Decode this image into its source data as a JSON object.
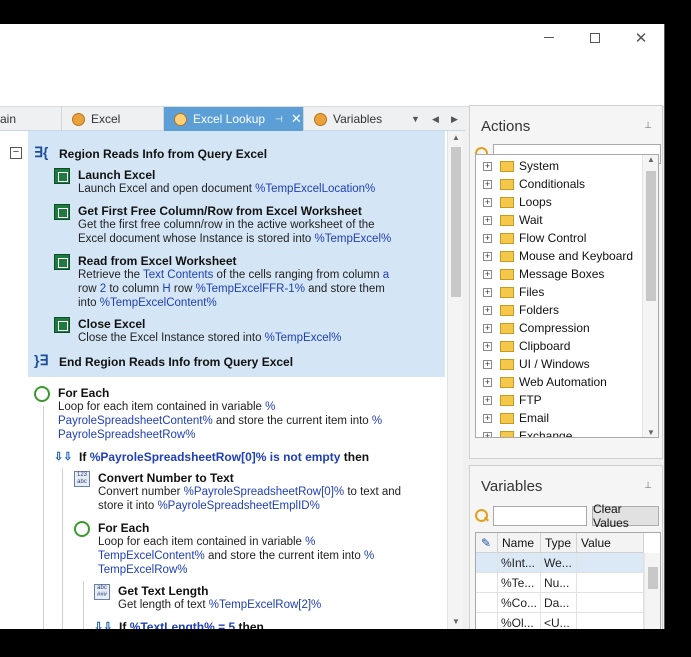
{
  "tabs": {
    "partial": "ain",
    "excel": "Excel",
    "excel_lookup": "Excel Lookup",
    "variables": "Variables"
  },
  "editor": {
    "region_start": "Region Reads Info from Query Excel",
    "region_end": "End Region Reads Info from Query Excel",
    "launch": {
      "title": "Launch Excel",
      "desc": "Launch Excel and open document",
      "var": "%TempExcelLocation%"
    },
    "free": {
      "title": "Get First Free Column/Row from Excel Worksheet",
      "l1": "Get the first free column/row in the active worksheet of the",
      "l2": "Excel document whose Instance is stored into",
      "var": "%TempExcel%"
    },
    "read": {
      "title": "Read from Excel Worksheet",
      "l1a": "Retrieve the",
      "l1v": "Text Contents",
      "l1b": "of the cells ranging from column",
      "l1v2": "a",
      "l2a": "row",
      "l2v": "2",
      "l2b": "to column",
      "l2v2": "H",
      "l2c": "row",
      "l2v3": "%TempExcelFFR-1%",
      "l2d": "and store them",
      "l3a": "into",
      "l3v": "%TempExcelContent%"
    },
    "close": {
      "title": "Close Excel",
      "desc": "Close the Excel Instance stored into",
      "var": "%TempExcel%"
    },
    "foreach1": {
      "title": "For Each",
      "l1": "Loop for each item contained in variable",
      "v1": "%",
      "v2": "PayroleSpreadsheetContent%",
      "mid": "and store the current item into",
      "v3": "%",
      "v4": "PayroleSpreadsheetRow%"
    },
    "if1": {
      "kw": "If",
      "cond": "%PayroleSpreadsheetRow[0]% is not empty",
      "then": "then"
    },
    "convert": {
      "title": "Convert Number to Text",
      "l1": "Convert number",
      "v1": "%PayroleSpreadsheetRow[0]%",
      "l1b": "to text and",
      "l2": "store it into",
      "v2": "%PayroleSpreadsheetEmplID%"
    },
    "foreach2": {
      "title": "For Each",
      "l1": "Loop for each item contained in variable",
      "v1": "%",
      "v2": "TempExcelContent%",
      "mid": "and store the current item into",
      "v3": "%",
      "v4": "TempExcelRow%"
    },
    "textlen": {
      "title": "Get Text Length",
      "desc": "Get length of text",
      "var": "%TempExcelRow[2]%"
    },
    "if2": {
      "kw": "If",
      "cond": "%TextLength% = 5",
      "then": "then"
    }
  },
  "actions": {
    "title": "Actions",
    "search_value": "",
    "items": [
      "System",
      "Conditionals",
      "Loops",
      "Wait",
      "Flow Control",
      "Mouse and Keyboard",
      "Message Boxes",
      "Files",
      "Folders",
      "Compression",
      "Clipboard",
      "UI / Windows",
      "Web Automation",
      "FTP",
      "Email",
      "Exchange"
    ]
  },
  "variables": {
    "title": "Variables",
    "search_value": "",
    "clear_label": "Clear Values",
    "columns": [
      "Name",
      "Type",
      "Value"
    ],
    "rows": [
      {
        "name": "%Int...",
        "type": "We...",
        "value": ""
      },
      {
        "name": "%Te...",
        "type": "Nu...",
        "value": ""
      },
      {
        "name": "%Co...",
        "type": "Da...",
        "value": ""
      },
      {
        "name": "%Ol...",
        "type": "<U...",
        "value": ""
      }
    ]
  },
  "colors": {
    "tab_active": "#5c9fd6",
    "region_bg": "#d4e6f6",
    "variable_text": "#1f3fb5"
  }
}
